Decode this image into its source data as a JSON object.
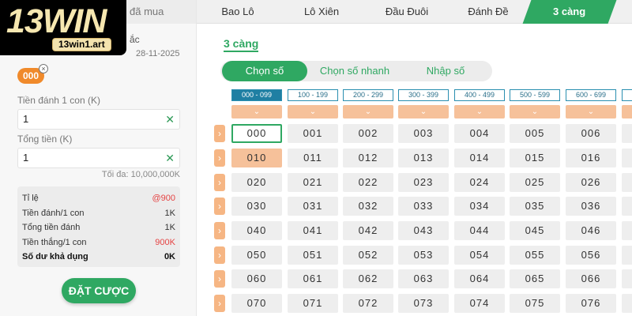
{
  "left": {
    "bought_tab": "đã mua",
    "logo_text": "13WIN",
    "logo_url": "13win1.art",
    "category_fragment": "ắc",
    "date": "28-11-2025",
    "selected_chip": "000",
    "chip_remove": "×",
    "stake_label": "Tiền đánh 1 con (K)",
    "stake_value": "1",
    "total_label": "Tổng tiền (K)",
    "total_value": "1",
    "clear_icon": "✕",
    "max_note": "Tối đa: 10,000,000K",
    "summary": [
      {
        "k": "Tỉ lệ",
        "v": "@900",
        "red": true
      },
      {
        "k": "Tiền đánh/1 con",
        "v": "1K",
        "red": false
      },
      {
        "k": "Tổng tiền đánh",
        "v": "1K",
        "red": false
      },
      {
        "k": "Tiền thắng/1 con",
        "v": "900K",
        "red": true
      },
      {
        "k": "Số dư khả dụng",
        "v": "0K",
        "bold": true
      }
    ],
    "bet_button": "ĐẶT CƯỢC"
  },
  "tabs": [
    "Bao Lô",
    "Lô Xiên",
    "Đầu Đuôi",
    "Đánh Đề",
    "3 càng"
  ],
  "active_tab": 4,
  "section_title": "3 càng",
  "modes": [
    "Chọn số",
    "Chọn số nhanh",
    "Nhập số"
  ],
  "active_mode": 0,
  "ranges": [
    "000 - 099",
    "100 - 199",
    "200 - 299",
    "300 - 399",
    "400 - 499",
    "500 - 599",
    "600 - 699"
  ],
  "active_range": 0,
  "chevron": "⌄",
  "row_arrow": "›",
  "grid": [
    [
      "000",
      "001",
      "002",
      "003",
      "004",
      "005",
      "006"
    ],
    [
      "010",
      "011",
      "012",
      "013",
      "014",
      "015",
      "016"
    ],
    [
      "020",
      "021",
      "022",
      "023",
      "024",
      "025",
      "026"
    ],
    [
      "030",
      "031",
      "032",
      "033",
      "034",
      "035",
      "036"
    ],
    [
      "040",
      "041",
      "042",
      "043",
      "044",
      "045",
      "046"
    ],
    [
      "050",
      "051",
      "052",
      "053",
      "054",
      "055",
      "056"
    ],
    [
      "060",
      "061",
      "062",
      "063",
      "064",
      "065",
      "066"
    ],
    [
      "070",
      "071",
      "072",
      "073",
      "074",
      "075",
      "076"
    ]
  ],
  "selected_cell": "000",
  "highlight_cell": "010",
  "colors": {
    "accent_green": "#2fa862",
    "chip_orange": "#f08a2b",
    "cell_orange": "#f6c19a",
    "range_blue": "#1f7fa3"
  }
}
